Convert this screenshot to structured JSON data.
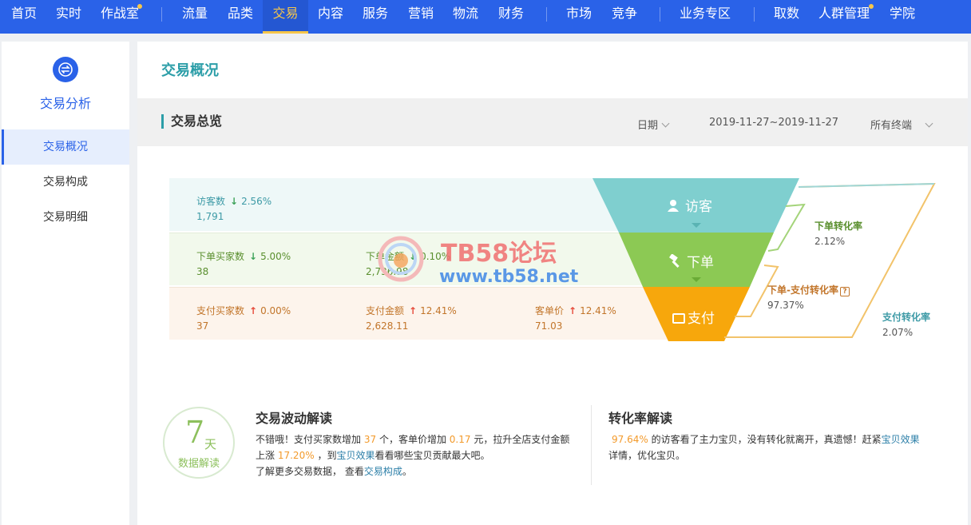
{
  "nav": {
    "items": [
      {
        "label": "首页"
      },
      {
        "label": "实时"
      },
      {
        "label": "作战室"
      },
      {
        "label": "流量"
      },
      {
        "label": "品类"
      },
      {
        "label": "交易"
      },
      {
        "label": "内容"
      },
      {
        "label": "服务"
      },
      {
        "label": "营销"
      },
      {
        "label": "物流"
      },
      {
        "label": "财务"
      },
      {
        "label": "市场"
      },
      {
        "label": "竞争"
      },
      {
        "label": "业务专区"
      },
      {
        "label": "取数"
      },
      {
        "label": "人群管理"
      },
      {
        "label": "学院"
      }
    ],
    "active": "交易",
    "accent": "#2a62e8",
    "active_color": "#f6c64a"
  },
  "sidebar": {
    "title": "交易分析",
    "icon": "exchange-icon",
    "items": [
      {
        "label": "交易概况"
      },
      {
        "label": "交易构成"
      },
      {
        "label": "交易明细"
      }
    ]
  },
  "main": {
    "title": "交易概况",
    "section": {
      "title": "交易总览",
      "date_label": "日期",
      "date_range": "2019-11-27~2019-11-27",
      "terminal": "所有终端"
    },
    "funnel": {
      "rows": [
        {
          "metrics": [
            {
              "label": "访客数",
              "trend": "↓",
              "change": "2.56%",
              "value": "1,791"
            }
          ]
        },
        {
          "metrics": [
            {
              "label": "下单买家数",
              "trend": "↓",
              "change": "5.00%",
              "value": "38"
            },
            {
              "label": "下单金额",
              "trend": "↓",
              "change": "0.10%",
              "value": "2,736.98"
            }
          ]
        },
        {
          "metrics": [
            {
              "label": "支付买家数",
              "trend": "↑",
              "change": "0.00%",
              "value": "37"
            },
            {
              "label": "支付金额",
              "trend": "↑",
              "change": "12.41%",
              "value": "2,628.11"
            },
            {
              "label": "客单价",
              "trend": "↑",
              "change": "12.41%",
              "value": "71.03"
            }
          ]
        }
      ],
      "stages": [
        "访客",
        "下单",
        "支付"
      ],
      "stage_colors": [
        "#7fcfcf",
        "#8cc954",
        "#f7a70c"
      ],
      "conversions": [
        {
          "label": "下单转化率",
          "value": "2.12%"
        },
        {
          "label": "下单-支付转化率",
          "value": "97.37%"
        },
        {
          "label": "支付转化率",
          "value": "2.07%"
        }
      ]
    },
    "watermark": {
      "line1": "TB58论坛",
      "line2": "www.tb58.net"
    },
    "badge": {
      "num": "7",
      "unit": "天",
      "text": "数据解读"
    },
    "wave": {
      "title": "交易波动解读",
      "p1a": "不错哦！支付买家数增加",
      "n1": "37",
      "p1b": "个，客单价增加",
      "n2": "0.17",
      "p1c": "元，拉升全店支付金额",
      "p2a": "上涨",
      "n3": "17.20%",
      "p2b": "，到",
      "link1": "宝贝效果",
      "p2c": "看看哪些宝贝贡献最大吧。",
      "p3a": "了解更多交易数据，  查看",
      "link2": "交易构成",
      "p3b": "。"
    },
    "rate": {
      "title": "转化率解读",
      "n1": "97.64%",
      "p1a": "的访客看了主力宝贝，没有转化就离开，真遗憾！赶紧",
      "link1": "宝贝效果",
      "p2": "详情，优化宝贝。"
    }
  }
}
